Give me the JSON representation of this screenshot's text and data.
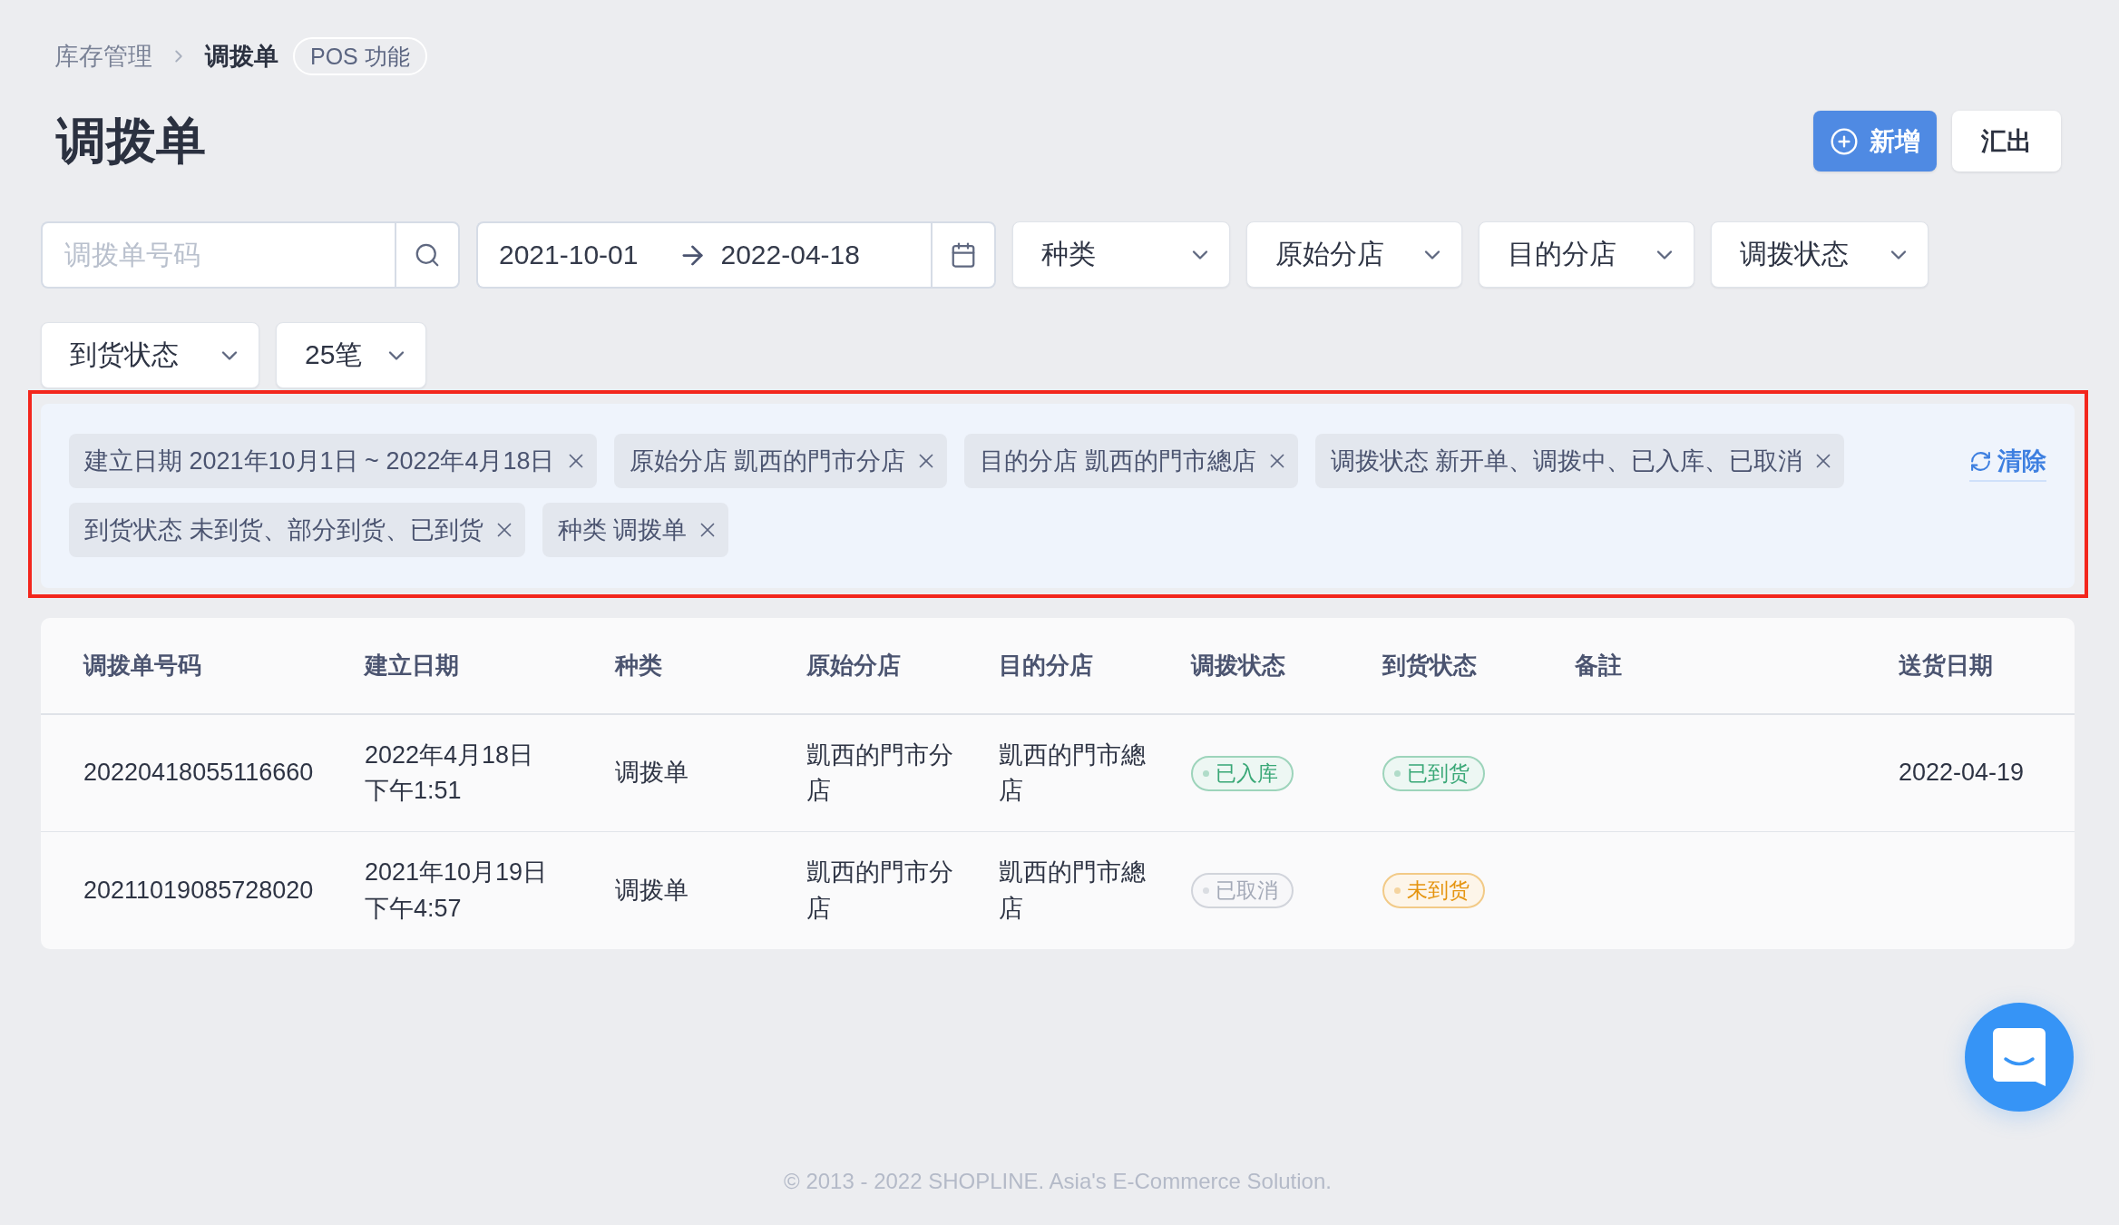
{
  "breadcrumb": {
    "items": [
      {
        "label": "库存管理",
        "current": false
      },
      {
        "label": "调拨单",
        "current": true
      }
    ],
    "tag": "POS 功能"
  },
  "header": {
    "title": "调拨单",
    "actions": [
      {
        "label": "新增",
        "kind": "primary"
      },
      {
        "label": "汇出",
        "kind": "secondary"
      }
    ]
  },
  "filters": {
    "search": {
      "placeholder": "调拨单号码"
    },
    "date_range": {
      "start": "2021-10-01",
      "end": "2022-04-18"
    },
    "dropdowns": [
      "种类",
      "原始分店",
      "目的分店",
      "调拨状态",
      "到货状态",
      "25笔"
    ]
  },
  "active_filters": {
    "chips": [
      "建立日期 2021年10月1日 ~ 2022年4月18日",
      "原始分店 凱西的門市分店",
      "目的分店 凱西的門市總店",
      "调拨状态 新开单、调拨中、已入库、已取消",
      "到货状态 未到货、部分到货、已到货",
      "种类 调拨单"
    ],
    "clear": "清除"
  },
  "table": {
    "columns": [
      "调拨单号码",
      "建立日期",
      "种类",
      "原始分店",
      "目的分店",
      "调拨状态",
      "到货状态",
      "备註",
      "送货日期"
    ],
    "rows": [
      {
        "number": "20220418055116660",
        "created": "2022年4月18日下午1:51",
        "type": "调拨单",
        "origin": "凱西的門市分店",
        "destination": "凱西的門市總店",
        "transfer_status": {
          "label": "已入库",
          "color": "#3aa877"
        },
        "arrival_status": {
          "label": "已到货",
          "color": "#3aa877"
        },
        "delivery_date": "2022-04-19"
      },
      {
        "number": "20211019085728020",
        "created": "2021年10月19日下午4:57",
        "type": "调拨单",
        "origin": "凱西的門市分店",
        "destination": "凱西的門市總店",
        "transfer_status": {
          "label": "已取消",
          "color": "#a3a9b7"
        },
        "arrival_status": {
          "label": "未到货",
          "color": "#e5940f"
        }
      }
    ]
  },
  "footer": "© 2013 - 2022 SHOPLINE. Asia's E-Commerce Solution."
}
